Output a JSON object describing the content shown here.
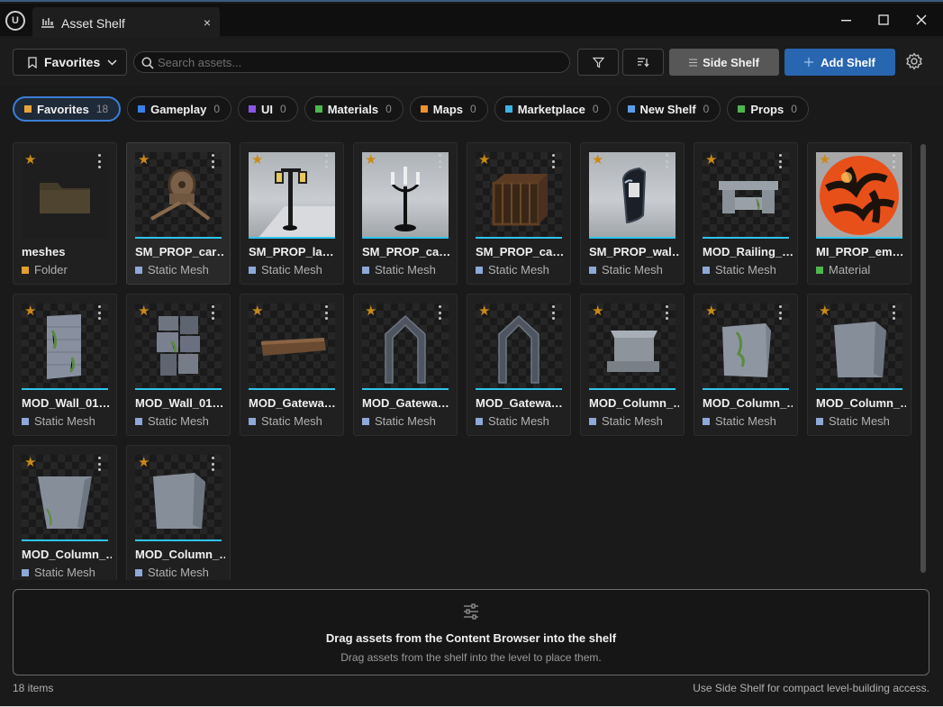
{
  "window": {
    "tab_title": "Asset Shelf",
    "close_glyph": "×",
    "minimize_glyph": "—",
    "maximize_glyph": "☐",
    "window_close_glyph": "✕",
    "logo_text": "U"
  },
  "toolbar": {
    "favorites_label": "Favorites",
    "search_placeholder": "Search assets...",
    "side_shelf_label": "Side Shelf",
    "add_shelf_label": "Add Shelf"
  },
  "chips": [
    {
      "name": "Favorites",
      "count": "18",
      "color": "#e8a338"
    },
    {
      "name": "Gameplay",
      "count": "0",
      "color": "#3a80e8"
    },
    {
      "name": "UI",
      "count": "0",
      "color": "#8a55e6"
    },
    {
      "name": "Materials",
      "count": "0",
      "color": "#4db64d"
    },
    {
      "name": "Maps",
      "count": "0",
      "color": "#f0902e"
    },
    {
      "name": "Marketplace",
      "count": "0",
      "color": "#3ab4e4"
    },
    {
      "name": "New Shelf",
      "count": "0",
      "color": "#5a9ee8"
    },
    {
      "name": "Props",
      "count": "0",
      "color": "#4db64d"
    }
  ],
  "assets": [
    {
      "name": "meshes",
      "type": "Folder",
      "type_color": "#e0a030",
      "thumb": "folder-icon"
    },
    {
      "name": "SM_PROP_car…",
      "type": "Static Mesh",
      "type_color": "#8ea8d8",
      "thumb": "cart-mesh"
    },
    {
      "name": "SM_PROP_la…",
      "type": "Static Mesh",
      "type_color": "#8ea8d8",
      "thumb": "lamp-post-mesh"
    },
    {
      "name": "SM_PROP_ca…",
      "type": "Static Mesh",
      "type_color": "#8ea8d8",
      "thumb": "candelabra-mesh"
    },
    {
      "name": "SM_PROP_ca…",
      "type": "Static Mesh",
      "type_color": "#8ea8d8",
      "thumb": "cage-mesh"
    },
    {
      "name": "SM_PROP_wal…",
      "type": "Static Mesh",
      "type_color": "#8ea8d8",
      "thumb": "wall-lamp-mesh"
    },
    {
      "name": "MOD_Railing_…",
      "type": "Static Mesh",
      "type_color": "#8ea8d8",
      "thumb": "railing-mesh"
    },
    {
      "name": "MI_PROP_em…",
      "type": "Material",
      "type_color": "#4db64d",
      "thumb": "lava-sphere"
    },
    {
      "name": "MOD_Wall_01…",
      "type": "Static Mesh",
      "type_color": "#8ea8d8",
      "thumb": "mossy-wall-mesh"
    },
    {
      "name": "MOD_Wall_01…",
      "type": "Static Mesh",
      "type_color": "#8ea8d8",
      "thumb": "stone-wall-mesh"
    },
    {
      "name": "MOD_Gatewa…",
      "type": "Static Mesh",
      "type_color": "#8ea8d8",
      "thumb": "plank-mesh"
    },
    {
      "name": "MOD_Gatewa…",
      "type": "Static Mesh",
      "type_color": "#8ea8d8",
      "thumb": "arch-mesh"
    },
    {
      "name": "MOD_Gatewa…",
      "type": "Static Mesh",
      "type_color": "#8ea8d8",
      "thumb": "arch-mesh"
    },
    {
      "name": "MOD_Column_…",
      "type": "Static Mesh",
      "type_color": "#8ea8d8",
      "thumb": "column-base-mesh"
    },
    {
      "name": "MOD_Column_…",
      "type": "Static Mesh",
      "type_color": "#8ea8d8",
      "thumb": "mossy-block-mesh"
    },
    {
      "name": "MOD_Column_…",
      "type": "Static Mesh",
      "type_color": "#8ea8d8",
      "thumb": "stone-block-mesh"
    },
    {
      "name": "MOD_Column_…",
      "type": "Static Mesh",
      "type_color": "#8ea8d8",
      "thumb": "tapered-block-mesh"
    },
    {
      "name": "MOD_Column_…",
      "type": "Static Mesh",
      "type_color": "#8ea8d8",
      "thumb": "stone-block-mesh"
    }
  ],
  "dropzone": {
    "title": "Drag assets from the Content Browser into the shelf",
    "subtitle": "Drag assets from the shelf into the level to place them."
  },
  "status": {
    "item_count": "18 items",
    "hint": "Use Side Shelf for compact level-building access."
  },
  "colors": {
    "accent_blue": "#2866b0",
    "underline_cyan": "#2ec4ea",
    "star_gold": "#c98a16"
  }
}
